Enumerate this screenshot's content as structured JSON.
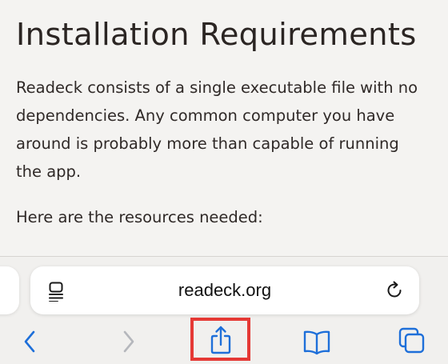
{
  "article": {
    "heading": "Installation Requirements",
    "paragraph_1": "Readeck consists of a single executable file with no dependencies. Any common computer you have around is probably more than capable of running the app.",
    "paragraph_2": "Here are the resources needed:"
  },
  "address_bar": {
    "url": "readeck.org",
    "left_icon": "reader-mode-icon",
    "right_icon": "reload-icon"
  },
  "toolbar": {
    "buttons": [
      {
        "icon": "back-chevron-icon",
        "enabled": true
      },
      {
        "icon": "forward-chevron-icon",
        "enabled": false
      },
      {
        "icon": "share-icon",
        "enabled": true,
        "highlighted": true
      },
      {
        "icon": "bookmarks-book-icon",
        "enabled": true
      },
      {
        "icon": "tabs-icon",
        "enabled": true
      }
    ]
  },
  "colors": {
    "accent": "#1e6fd9",
    "disabled": "#b5b7bc",
    "highlight": "#e53935",
    "page_background": "#f4f3f1",
    "text": "#2c2624"
  }
}
